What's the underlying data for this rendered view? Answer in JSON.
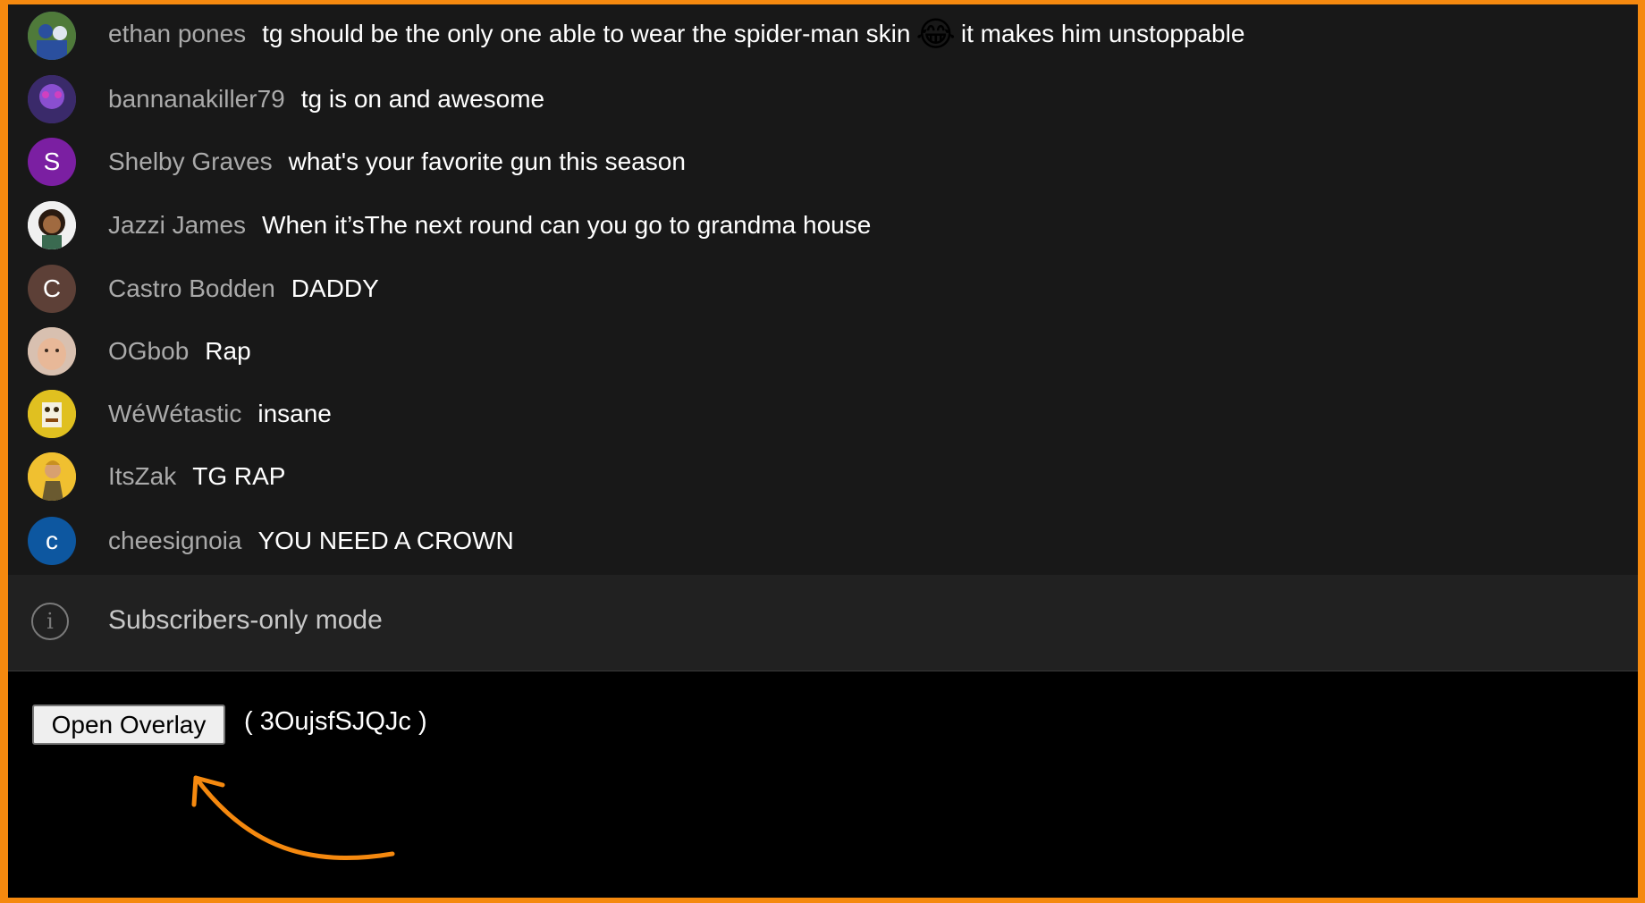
{
  "chat": {
    "messages": [
      {
        "author": "ethan pones",
        "text_before": "tg should be the only one able to wear the spider-man skin",
        "emoji": "😂",
        "text_after": "it makes him unstoppable",
        "avatar": "photo-icon",
        "avatar_color": "#3b5b87"
      },
      {
        "author": "bannanakiller79",
        "text": "tg is on and awesome",
        "avatar": "photo-icon",
        "avatar_color": "#5a3b8c"
      },
      {
        "author": "Shelby Graves",
        "text": "what's your favorite gun this season",
        "avatar_letter": "S",
        "avatar_color": "#7b1fa2"
      },
      {
        "author": "Jazzi James",
        "text": "When it’sThe next round can you go to grandma house",
        "avatar": "photo-icon",
        "avatar_color": "#e8e8e8"
      },
      {
        "author": "Castro Bodden",
        "text": "DADDY",
        "avatar_letter": "C",
        "avatar_color": "#5d4037"
      },
      {
        "author": "OGbob",
        "text": "Rap",
        "avatar": "photo-icon",
        "avatar_color": "#c9a48a"
      },
      {
        "author": "WéWétastic",
        "text": "insane",
        "avatar": "photo-icon",
        "avatar_color": "#e0c020"
      },
      {
        "author": "ItsZak",
        "text": "TG RAP",
        "avatar": "photo-icon",
        "avatar_color": "#e0b030"
      },
      {
        "author": "cheesignoia",
        "text": "YOU NEED A CROWN",
        "avatar_letter": "c",
        "avatar_color": "#0d57a0"
      }
    ]
  },
  "banner": {
    "icon": "info-icon",
    "text": "Subscribers-only mode"
  },
  "overlay": {
    "button_label": "Open Overlay",
    "video_id": "( 3OujsfSJQJc )"
  },
  "colors": {
    "frame": "#f5890f",
    "chat_bg": "#181818",
    "author": "#aaaaaa",
    "message": "#ffffff"
  }
}
